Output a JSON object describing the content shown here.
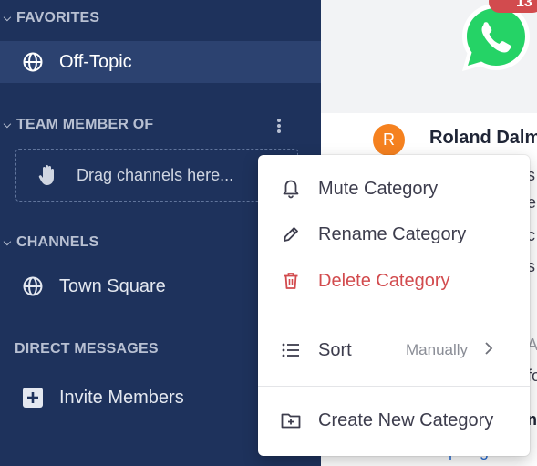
{
  "sidebar": {
    "favorites": {
      "header": "FAVORITES",
      "items": [
        {
          "label": "Off-Topic",
          "icon": "globe-icon",
          "active": true
        }
      ]
    },
    "team_member_of": {
      "header": "TEAM MEMBER OF",
      "drag_hint": "Drag channels here..."
    },
    "channels": {
      "header": "CHANNELS",
      "items": [
        {
          "label": "Town Square",
          "icon": "globe-icon"
        }
      ]
    },
    "direct_messages": {
      "header": "DIRECT MESSAGES",
      "items": [
        {
          "label": "Invite Members",
          "icon": "plus-square-icon"
        }
      ]
    }
  },
  "main": {
    "notification_count": "13",
    "avatar_initial": "R",
    "author": "Roland Dalm",
    "fragments": [
      "s",
      "re",
      "c",
      "s",
      "A",
      "fo",
      "n"
    ],
    "link_text": "https://github"
  },
  "context_menu": {
    "items": [
      {
        "label": "Mute Category",
        "icon": "bell-icon"
      },
      {
        "label": "Rename Category",
        "icon": "pencil-icon"
      },
      {
        "label": "Delete Category",
        "icon": "trash-icon",
        "danger": true
      },
      {
        "label": "Sort",
        "icon": "list-icon",
        "value": "Manually"
      },
      {
        "label": "Create New Category",
        "icon": "folder-plus-icon"
      }
    ]
  },
  "colors": {
    "sidebar_bg": "#1e325c",
    "active_row": "#2c4270",
    "danger": "#d24b4e",
    "avatar": "#f5811f",
    "link": "#2a6fd6",
    "whatsapp": "#25d366"
  }
}
